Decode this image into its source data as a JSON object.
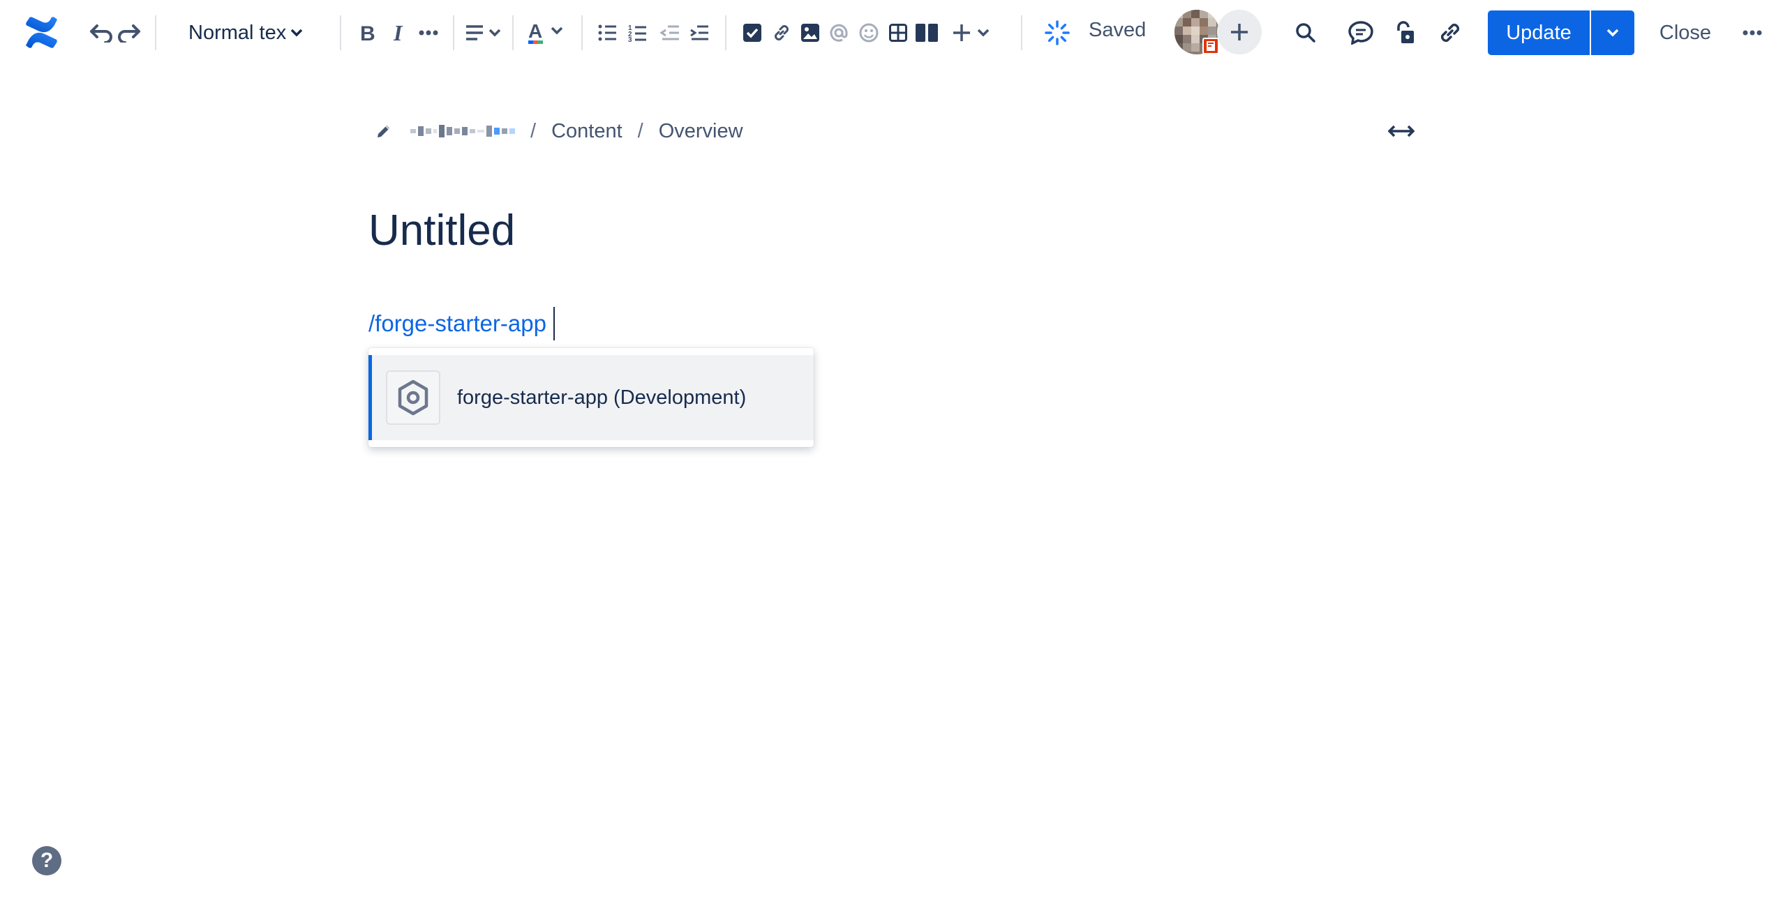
{
  "toolbar": {
    "text_style": "Normal text",
    "saved_label": "Saved",
    "update_label": "Update",
    "close_label": "Close",
    "accent_color": "#0c66e4",
    "icons": [
      "confluence-logo-icon",
      "undo-icon",
      "redo-icon",
      "bold-icon",
      "italic-icon",
      "more-formatting-icon",
      "align-icon",
      "text-color-icon",
      "bullet-list-icon",
      "numbered-list-icon",
      "outdent-icon",
      "indent-icon",
      "task-icon",
      "link-icon",
      "image-icon",
      "mention-icon",
      "emoji-icon",
      "table-icon",
      "layout-icon",
      "insert-icon",
      "loading-icon",
      "search-icon",
      "comment-icon",
      "restrictions-icon",
      "copy-link-icon",
      "more-icon"
    ]
  },
  "breadcrumb": {
    "items": [
      "Content",
      "Overview"
    ]
  },
  "editor": {
    "title": "Untitled",
    "command_text": "/forge-starter-app"
  },
  "typeahead": {
    "items": [
      {
        "label": "forge-starter-app (Development)",
        "icon": "forge-app-icon"
      }
    ]
  },
  "help": {
    "icon": "help-icon",
    "label": "?"
  }
}
